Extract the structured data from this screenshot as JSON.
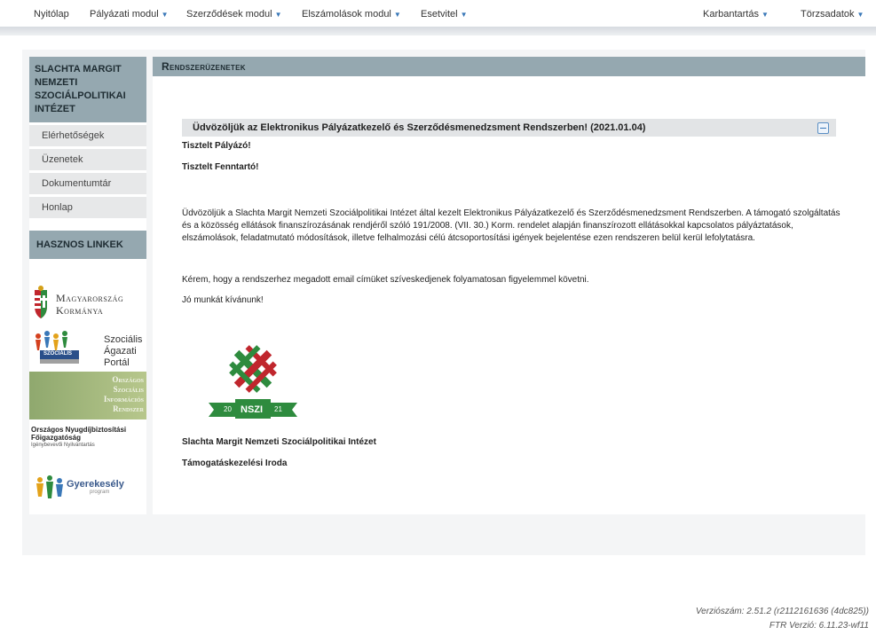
{
  "nav": {
    "home": "Nyitólap",
    "tender": "Pályázati modul",
    "contracts": "Szerződések modul",
    "accounts": "Elszámolások modul",
    "events": "Esetvitel",
    "maintenance": "Karbantartás",
    "masterdata": "Törzsadatok"
  },
  "sidebar": {
    "institute_title": "SLACHTA MARGIT NEMZETI SZOCIÁLPOLITIKAI INTÉZET",
    "items": [
      "Elérhetőségek",
      "Üzenetek",
      "Dokumentumtár",
      "Honlap"
    ],
    "links_title": "HASZNOS LINKEK",
    "links": {
      "gov_line1": "Magyarország",
      "gov_line2": "Kormánya",
      "szocialis": "Szociális Ágazati Portál",
      "szocialis_line1": "Szociális",
      "szocialis_line2": "Ágazati",
      "szocialis_line3": "Portál",
      "osir_line1": "Országos",
      "osir_line2": "Szociális",
      "osir_line3": "Információs",
      "osir_line4": "Rendszer",
      "pension_line1": "Országos Nyugdíjbiztosítási",
      "pension_line2": "Főigazgatóság",
      "pension_line3": "Igénybevevői Nyilvántartás",
      "child": "Gyerekesély",
      "child_sub": "program"
    }
  },
  "main": {
    "title": "Rendszerüzenetek",
    "message": {
      "header": "Üdvözöljük az Elektronikus Pályázatkezelő és Szerződésmenedzsment Rendszerben! (2021.01.04)",
      "greeting1": "Tisztelt Pályázó!",
      "greeting2": "Tisztelt Fenntartó!",
      "paragraph1": "Üdvözöljük a Slachta Margit Nemzeti Szociálpolitikai Intézet által kezelt Elektronikus Pályázatkezelő és Szerződésmenedzsment Rendszerben. A támogató szolgáltatás és a közösség ellátások finanszírozásának rendjéről szóló 191/2008. (VII. 30.) Korm. rendelet alapján finanszírozott ellátásokkal kapcsolatos pályáztatások, elszámolások, feladatmutató módosítások, illetve felhalmozási célú átcsoportosítási igények bejelentése ezen rendszeren belül kerül lefolytatásra.",
      "paragraph2": "Kérem, hogy a rendszerhez megadott email címüket szíveskedjenek folyamatosan figyelemmel követni.",
      "closing": "Jó munkát kívánunk!",
      "logo_text": "NSZI",
      "logo_year_left": "20",
      "logo_year_right": "21",
      "signature1": "Slachta Margit Nemzeti Szociálpolitikai Intézet",
      "signature2": "Támogatáskezelési Iroda"
    }
  },
  "footer": {
    "version": "Verziószám: 2.51.2 (r2112161636 (4dc825))",
    "ftr": "FTR Verzió: 6.11.23-wf11"
  },
  "colors": {
    "header_bg": "#95a8b0",
    "accent": "#3a78b8",
    "logo_green": "#2e8b3e",
    "logo_red": "#c0262d"
  }
}
